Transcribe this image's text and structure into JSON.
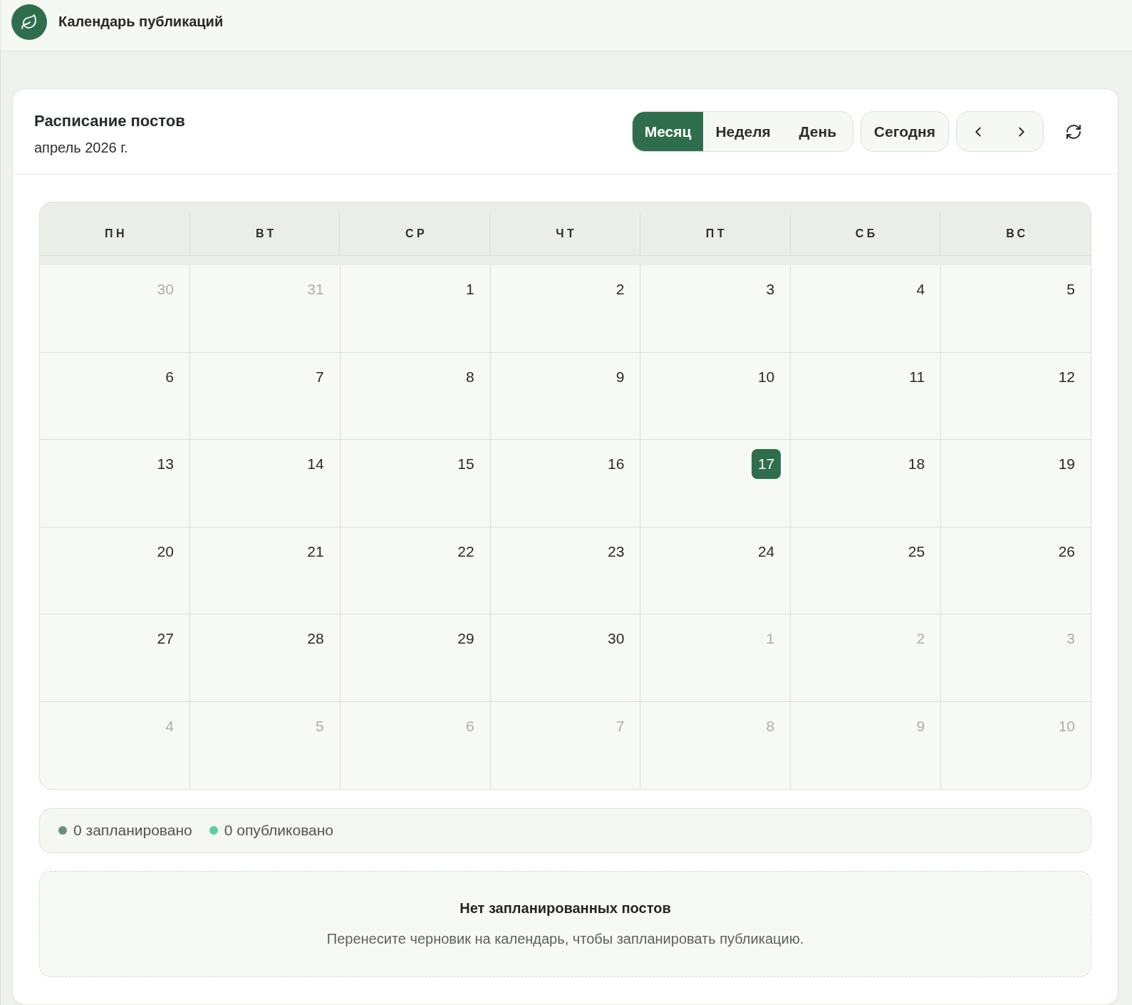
{
  "app_bar": {
    "title": "Календарь публикаций"
  },
  "schedule": {
    "title": "Расписание постов",
    "subtitle": "апрель 2026 г.",
    "view_tabs": [
      {
        "label": "Месяц",
        "selected": true
      },
      {
        "label": "Неделя",
        "selected": false
      },
      {
        "label": "День",
        "selected": false
      }
    ],
    "today_button": "Сегодня"
  },
  "calendar": {
    "weekdays": [
      "ПН",
      "ВТ",
      "СР",
      "ЧТ",
      "ПТ",
      "СБ",
      "ВС"
    ],
    "weeks": [
      {
        "days": [
          {
            "day": "30",
            "in_month": false,
            "today": false
          },
          {
            "day": "31",
            "in_month": false,
            "today": false
          },
          {
            "day": "1",
            "in_month": true,
            "today": false
          },
          {
            "day": "2",
            "in_month": true,
            "today": false
          },
          {
            "day": "3",
            "in_month": true,
            "today": false
          },
          {
            "day": "4",
            "in_month": true,
            "today": false
          },
          {
            "day": "5",
            "in_month": true,
            "today": false
          }
        ]
      },
      {
        "days": [
          {
            "day": "6",
            "in_month": true,
            "today": false
          },
          {
            "day": "7",
            "in_month": true,
            "today": false
          },
          {
            "day": "8",
            "in_month": true,
            "today": false
          },
          {
            "day": "9",
            "in_month": true,
            "today": false
          },
          {
            "day": "10",
            "in_month": true,
            "today": false
          },
          {
            "day": "11",
            "in_month": true,
            "today": false
          },
          {
            "day": "12",
            "in_month": true,
            "today": false
          }
        ]
      },
      {
        "days": [
          {
            "day": "13",
            "in_month": true,
            "today": false
          },
          {
            "day": "14",
            "in_month": true,
            "today": false
          },
          {
            "day": "15",
            "in_month": true,
            "today": false
          },
          {
            "day": "16",
            "in_month": true,
            "today": false
          },
          {
            "day": "17",
            "in_month": true,
            "today": true
          },
          {
            "day": "18",
            "in_month": true,
            "today": false
          },
          {
            "day": "19",
            "in_month": true,
            "today": false
          }
        ]
      },
      {
        "days": [
          {
            "day": "20",
            "in_month": true,
            "today": false
          },
          {
            "day": "21",
            "in_month": true,
            "today": false
          },
          {
            "day": "22",
            "in_month": true,
            "today": false
          },
          {
            "day": "23",
            "in_month": true,
            "today": false
          },
          {
            "day": "24",
            "in_month": true,
            "today": false
          },
          {
            "day": "25",
            "in_month": true,
            "today": false
          },
          {
            "day": "26",
            "in_month": true,
            "today": false
          }
        ]
      },
      {
        "days": [
          {
            "day": "27",
            "in_month": true,
            "today": false
          },
          {
            "day": "28",
            "in_month": true,
            "today": false
          },
          {
            "day": "29",
            "in_month": true,
            "today": false
          },
          {
            "day": "30",
            "in_month": true,
            "today": false
          },
          {
            "day": "1",
            "in_month": false,
            "today": false
          },
          {
            "day": "2",
            "in_month": false,
            "today": false
          },
          {
            "day": "3",
            "in_month": false,
            "today": false
          }
        ]
      },
      {
        "days": [
          {
            "day": "4",
            "in_month": false,
            "today": false
          },
          {
            "day": "5",
            "in_month": false,
            "today": false
          },
          {
            "day": "6",
            "in_month": false,
            "today": false
          },
          {
            "day": "7",
            "in_month": false,
            "today": false
          },
          {
            "day": "8",
            "in_month": false,
            "today": false
          },
          {
            "day": "9",
            "in_month": false,
            "today": false
          },
          {
            "day": "10",
            "in_month": false,
            "today": false
          }
        ]
      }
    ]
  },
  "legend": [
    {
      "label": "0 запланировано",
      "color": "#6b8f76"
    },
    {
      "label": "0 опубликовано",
      "color": "#5ccf9e"
    }
  ],
  "empty_state": {
    "title": "Нет запланированных постов",
    "message": "Перенесите черновик на календарь, чтобы запланировать публикацию."
  }
}
